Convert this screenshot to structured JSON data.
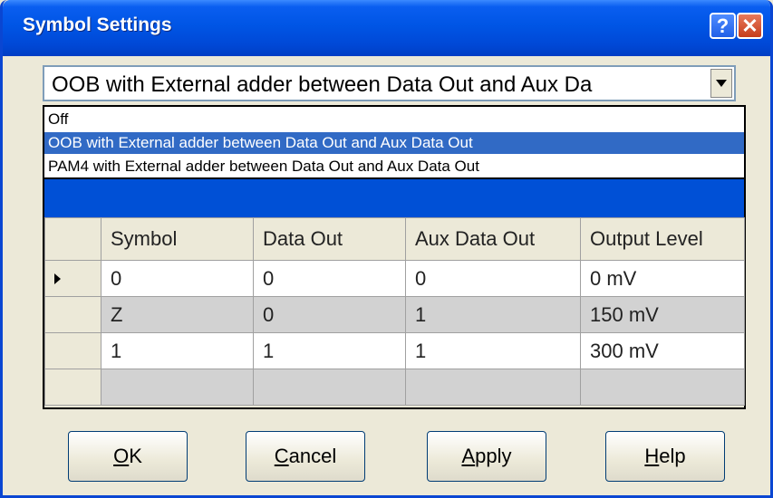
{
  "window": {
    "title": "Symbol Settings",
    "help_label": "?",
    "close_label": "✕"
  },
  "combo": {
    "selected": "OOB with External adder between Data Out and Aux Da"
  },
  "dropdown": {
    "options": [
      "Off",
      "OOB with External adder between Data Out and Aux Data Out",
      "PAM4 with External adder between Data Out and Aux Data Out"
    ],
    "selected_index": 1
  },
  "grid": {
    "headers": [
      "Symbol",
      "Data Out",
      "Aux Data Out",
      "Output Level"
    ],
    "rows": [
      [
        "0",
        "0",
        "0",
        "0 mV"
      ],
      [
        "Z",
        "0",
        "1",
        "150 mV"
      ],
      [
        "1",
        "1",
        "1",
        "300 mV"
      ]
    ]
  },
  "buttons": {
    "ok": {
      "accel": "O",
      "rest": "K"
    },
    "cancel": {
      "accel": "C",
      "rest": "ancel"
    },
    "apply": {
      "accel": "A",
      "rest": "pply"
    },
    "help": {
      "accel": "H",
      "rest": "elp"
    }
  }
}
